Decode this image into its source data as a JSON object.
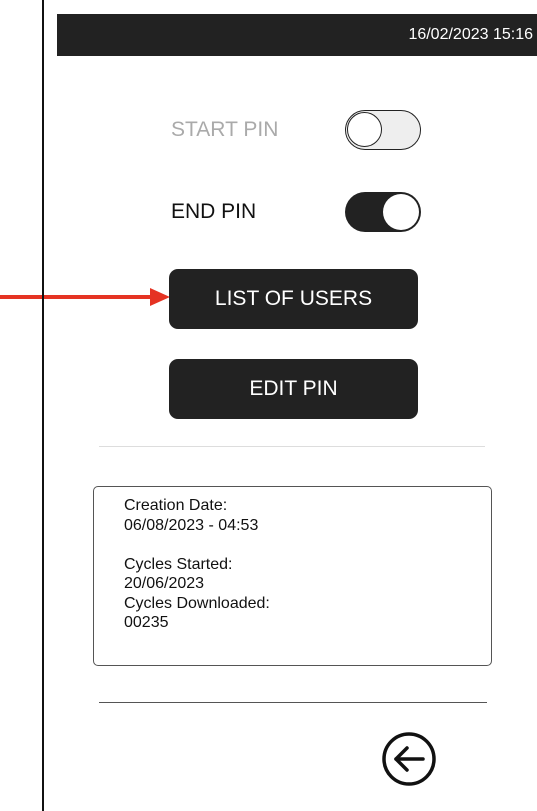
{
  "status_bar": {
    "datetime": "16/02/2023 15:16"
  },
  "toggles": {
    "start_pin": {
      "label": "START PIN",
      "state": "off"
    },
    "end_pin": {
      "label": "END PIN",
      "state": "on"
    }
  },
  "buttons": {
    "list_of_users": "LIST OF USERS",
    "edit_pin": "EDIT PIN"
  },
  "info": {
    "creation_date_label": "Creation Date:",
    "creation_date_value": "06/08/2023 - 04:53",
    "cycles_started_label": "Cycles Started:",
    "cycles_started_value": "20/06/2023",
    "cycles_downloaded_label": "Cycles Downloaded:",
    "cycles_downloaded_value": "00235"
  },
  "icons": {
    "back": "arrow-left-circle-icon",
    "pointer": "red-arrow-icon"
  },
  "colors": {
    "dark": "#222222",
    "disabled_text": "#aaaaaa",
    "annotation": "#e53323"
  }
}
